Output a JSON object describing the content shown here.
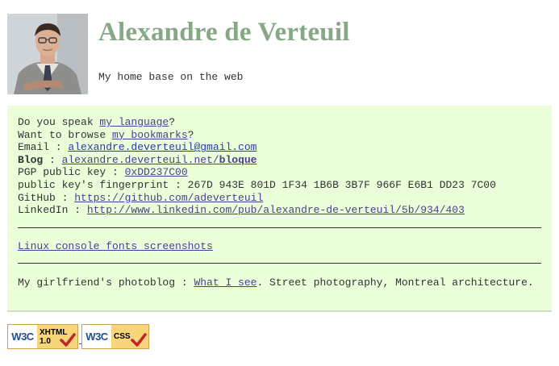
{
  "header": {
    "title": "Alexandre de Verteuil",
    "tagline": "My home base on the web",
    "photo_alt": "Portrait of Alexandre de Verteuil"
  },
  "info": {
    "language": {
      "prefix": "Do you speak ",
      "link": "my language",
      "suffix": "?"
    },
    "bookmarks": {
      "prefix": "Want to browse ",
      "link": "my bookmarks",
      "suffix": "?"
    },
    "email": {
      "label": "Email : ",
      "value": "alexandre.deverteuil@gmail.com"
    },
    "blog": {
      "label": "Blog",
      "sep": " : ",
      "link_plain": "alexandre.deverteuil.net/",
      "link_bold": "bloque"
    },
    "pgp": {
      "label": "PGP public key : ",
      "value": "0xDD237C00"
    },
    "fingerprint": {
      "label": "public key's fingerprint : ",
      "value": "267D 943E 801D 1F34 1B6B 3B7F 966F E6B1 DD23 7C00"
    },
    "github": {
      "label": "GitHub : ",
      "value": "https://github.com/adeverteuil"
    },
    "linkedin": {
      "label": "LinkedIn : ",
      "value": "http://www.linkedin.com/pub/alexandre-de-verteuil/5b/934/403"
    }
  },
  "fonts_link": "Linux console fonts screenshots",
  "girlfriend": {
    "prefix": "My girlfriend's photoblog : ",
    "link": "What I see",
    "suffix": ". Street photography, Montreal architecture."
  },
  "badges": {
    "xhtml": {
      "w3c": "W3C",
      "line1": "XHTML",
      "line2": "1.0"
    },
    "css": {
      "w3c": "W3C",
      "line1": "CSS"
    }
  },
  "colors": {
    "title": "#86a886",
    "panel_bg": "#eaffd9",
    "link": "#4b3f8c",
    "email_link": "#2b36b8",
    "badge_gold": "#f8d47a",
    "check_red": "#c0272d"
  }
}
